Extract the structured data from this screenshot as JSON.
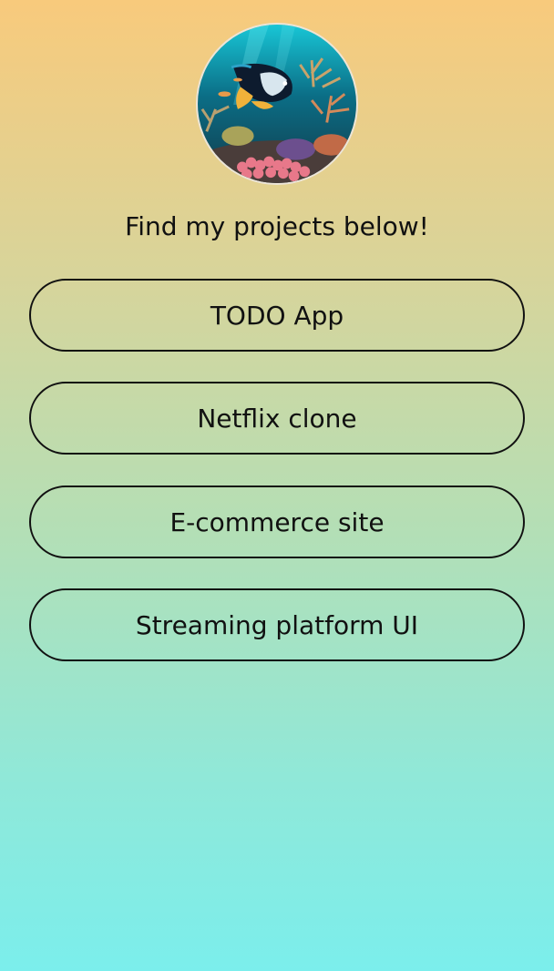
{
  "profile": {
    "avatar_alt": "underwater coral reef with fish"
  },
  "heading": "Find my projects below!",
  "projects": [
    {
      "label": "TODO App"
    },
    {
      "label": "Netflix clone"
    },
    {
      "label": "E-commerce site"
    },
    {
      "label": "Streaming platform UI"
    }
  ],
  "colors": {
    "gradient_top": "#f8ca7c",
    "gradient_bottom": "#7beeec",
    "button_border": "#111111"
  }
}
